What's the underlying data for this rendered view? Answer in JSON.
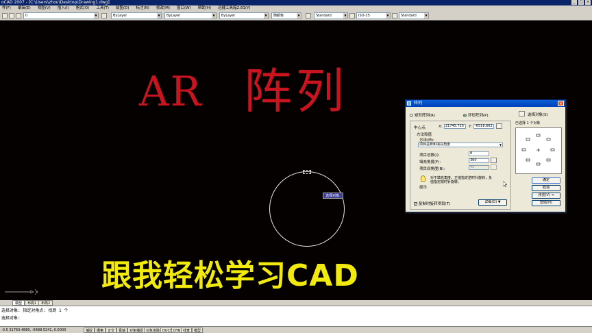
{
  "window": {
    "title": "oCAD 2007 - [C:\\Users\\zhou\\Desktop\\Drawing1.dwg]",
    "buttons": [
      "_",
      "□",
      "×"
    ]
  },
  "menu": [
    "件(F)",
    "编辑(E)",
    "视图(V)",
    "插入(I)",
    "格式(O)",
    "工具(T)",
    "绘图(D)",
    "标注(N)",
    "修改(M)",
    "窗口(W)",
    "帮助(H)",
    "迅捷工具箱2.81(Y)"
  ],
  "toolbar": {
    "layer_value": "0",
    "color_value": "ByLayer",
    "linetype_value": "ByLayer",
    "lineweight_value": "ByLayer",
    "plotstyle_value": "随颜色",
    "textstyle_value": "Standard",
    "dimstyle_value": "ISO-25",
    "tablestyle_value": "Standard"
  },
  "canvas": {
    "heading_left": "AR",
    "heading_right": "阵列",
    "overlay_caption": "跟我轻松学习CAD",
    "tooltip": "选择对象:",
    "colors": {
      "heading": "#c8141e",
      "overlay": "#f2ea0c",
      "background": "#050101"
    }
  },
  "tabs": {
    "model": "模型",
    "layout1": "布局1",
    "layout2": "布局2"
  },
  "command": {
    "line1": "选择对象: 指定对角点: 找到 1 个",
    "line2": "选择对象:"
  },
  "status": {
    "coords": "-0.5  21760.4880, -6488.5241, 0.0000",
    "buttons": [
      "捕捉",
      "栅格",
      "正交",
      "极轴",
      "对象捕捉",
      "对象追踪",
      "DUCS",
      "DYN",
      "线宽",
      "模型"
    ]
  },
  "dialog": {
    "title": "阵列",
    "close": "×",
    "mode_rect": "矩形阵列(R)",
    "mode_polar": "环形阵列(P)",
    "select_objects_button": "选择对象(S)",
    "selected_count": "已选择 1 个对象",
    "center_label": "中心点:",
    "center_x_label": "X:",
    "center_x": "21745.725",
    "center_y_label": "Y:",
    "center_y": "-6516.662",
    "method_group": "方法和值",
    "method_label": "方法(M):",
    "method_value": "项目总数和填充角度",
    "items_label": "项目总数(I):",
    "items_value": "8",
    "fill_label": "填充角度(F):",
    "fill_value": "360",
    "between_label": "项目间角度(B):",
    "between_value": "45",
    "hint_text_1": "对于填充角度，正值指定逆时针旋转，负",
    "hint_text_2": "值指定顺时针旋转。",
    "hint_label": "提示",
    "rotate_checkbox": "复制时旋转项目(T)",
    "details_button": "详细(O) ▼",
    "ok": "确定",
    "cancel": "取消",
    "preview": "预览(V) <",
    "help": "帮助(H)"
  }
}
